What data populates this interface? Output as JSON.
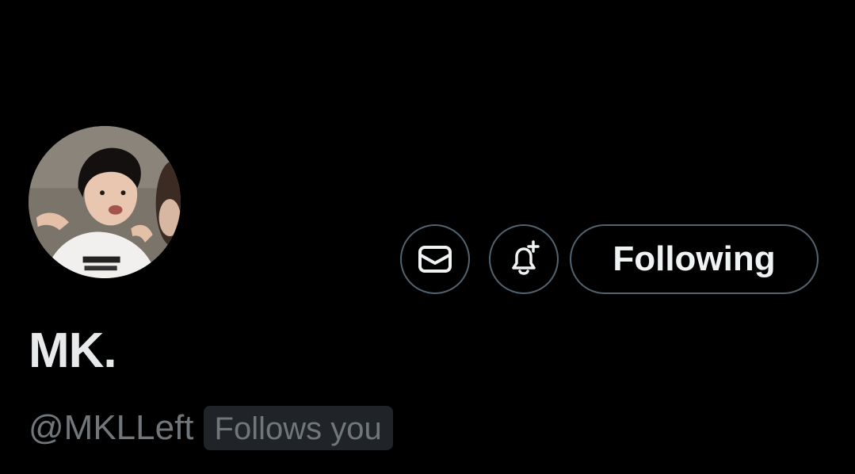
{
  "profile": {
    "display_name": "MK.",
    "handle": "@MKLLeft",
    "follows_you_label": "Follows you",
    "avatar_icon": "profile-photo"
  },
  "actions": {
    "message_icon": "envelope-icon",
    "notify_icon": "bell-plus-icon",
    "following_label": "Following"
  },
  "colors": {
    "background": "#000000",
    "primary_text": "#e7e9ea",
    "secondary_text": "#71767b",
    "button_border": "#536471",
    "badge_background": "#202327"
  }
}
